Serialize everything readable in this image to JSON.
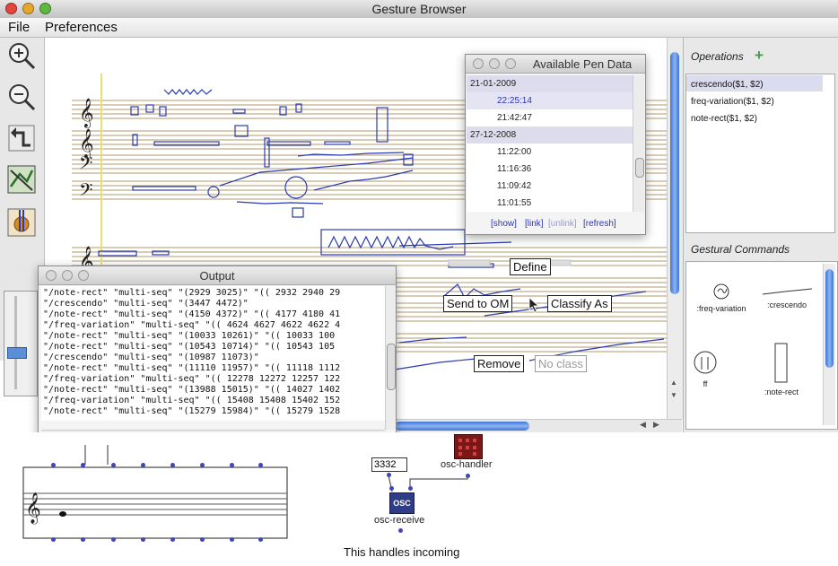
{
  "window": {
    "title": "Gesture Browser"
  },
  "menubar": {
    "items": [
      "File",
      "Preferences"
    ]
  },
  "toolbar": {
    "tools": [
      "zoom-in-icon",
      "zoom-out-icon",
      "undo-arrow-icon",
      "gesture-edit-icon",
      "gesture-tool-icon"
    ],
    "slider_icon": "slider-icon"
  },
  "pen_data": {
    "title": "Available Pen Data",
    "groups": [
      {
        "date": "21-01-2009",
        "times": [
          "22:25:14",
          "21:42:47"
        ]
      },
      {
        "date": "27-12-2008",
        "times": [
          "11:22:00",
          "11:16:36",
          "11:09:42",
          "11:01:55"
        ]
      }
    ],
    "selected_time": "22:25:14",
    "links": [
      "[show]",
      "[link]",
      "[unlink]",
      "[refresh]"
    ]
  },
  "output": {
    "title": "Output",
    "lines": [
      "\"/note-rect\" \"multi-seq\" \"(2929 3025)\" \"(( 2932 2940 29",
      "\"/crescendo\" \"multi-seq\" \"(3447 4472)\"",
      "\"/note-rect\" \"multi-seq\" \"(4150 4372)\" \"(( 4177 4180 41",
      "\"/freq-variation\" \"multi-seq\" \"(( 4624 4627 4622 4622 4",
      "\"/note-rect\" \"multi-seq\" \"(10033 10261)\" \"(( 10033 100",
      "\"/note-rect\" \"multi-seq\" \"(10543 10714)\" \"(( 10543 105",
      "\"/crescendo\" \"multi-seq\" \"(10987 11073)\"",
      "\"/note-rect\" \"multi-seq\" \"(11110 11957)\" \"(( 11118 1112",
      "\"/freq-variation\" \"multi-seq\" \"(( 12278 12272 12257 122",
      "\"/note-rect\" \"multi-seq\" \"(13988 15015)\" \"(( 14027 1402",
      "\"/freq-variation\" \"multi-seq\" \"(( 15408 15408 15402 152",
      "\"/note-rect\" \"multi-seq\" \"(15279 15984)\" \"(( 15279 1528"
    ]
  },
  "context": {
    "define": "Define",
    "send": "Send to OM",
    "classify": "Classify As",
    "remove": "Remove",
    "noclass": "No class"
  },
  "operations": {
    "title": "Operations",
    "items": [
      "crescendo($1, $2)",
      "freq-variation($1, $2)",
      "note-rect($1, $2)"
    ]
  },
  "gestural_commands": {
    "title": "Gestural Commands",
    "items": [
      ":freq-variation",
      ":crescendo",
      "ff",
      ":note-rect"
    ]
  },
  "patch": {
    "number_box": "3332",
    "osc_handler": "osc-handler",
    "osc_receive": "osc-receive",
    "osc_icon_text": "OSC",
    "comment": "This handles incoming"
  },
  "colors": {
    "ink": "#2a3bb0",
    "staff": "#b09a6c",
    "selection": "#dcdcef",
    "date_row": "#dcdcec"
  }
}
